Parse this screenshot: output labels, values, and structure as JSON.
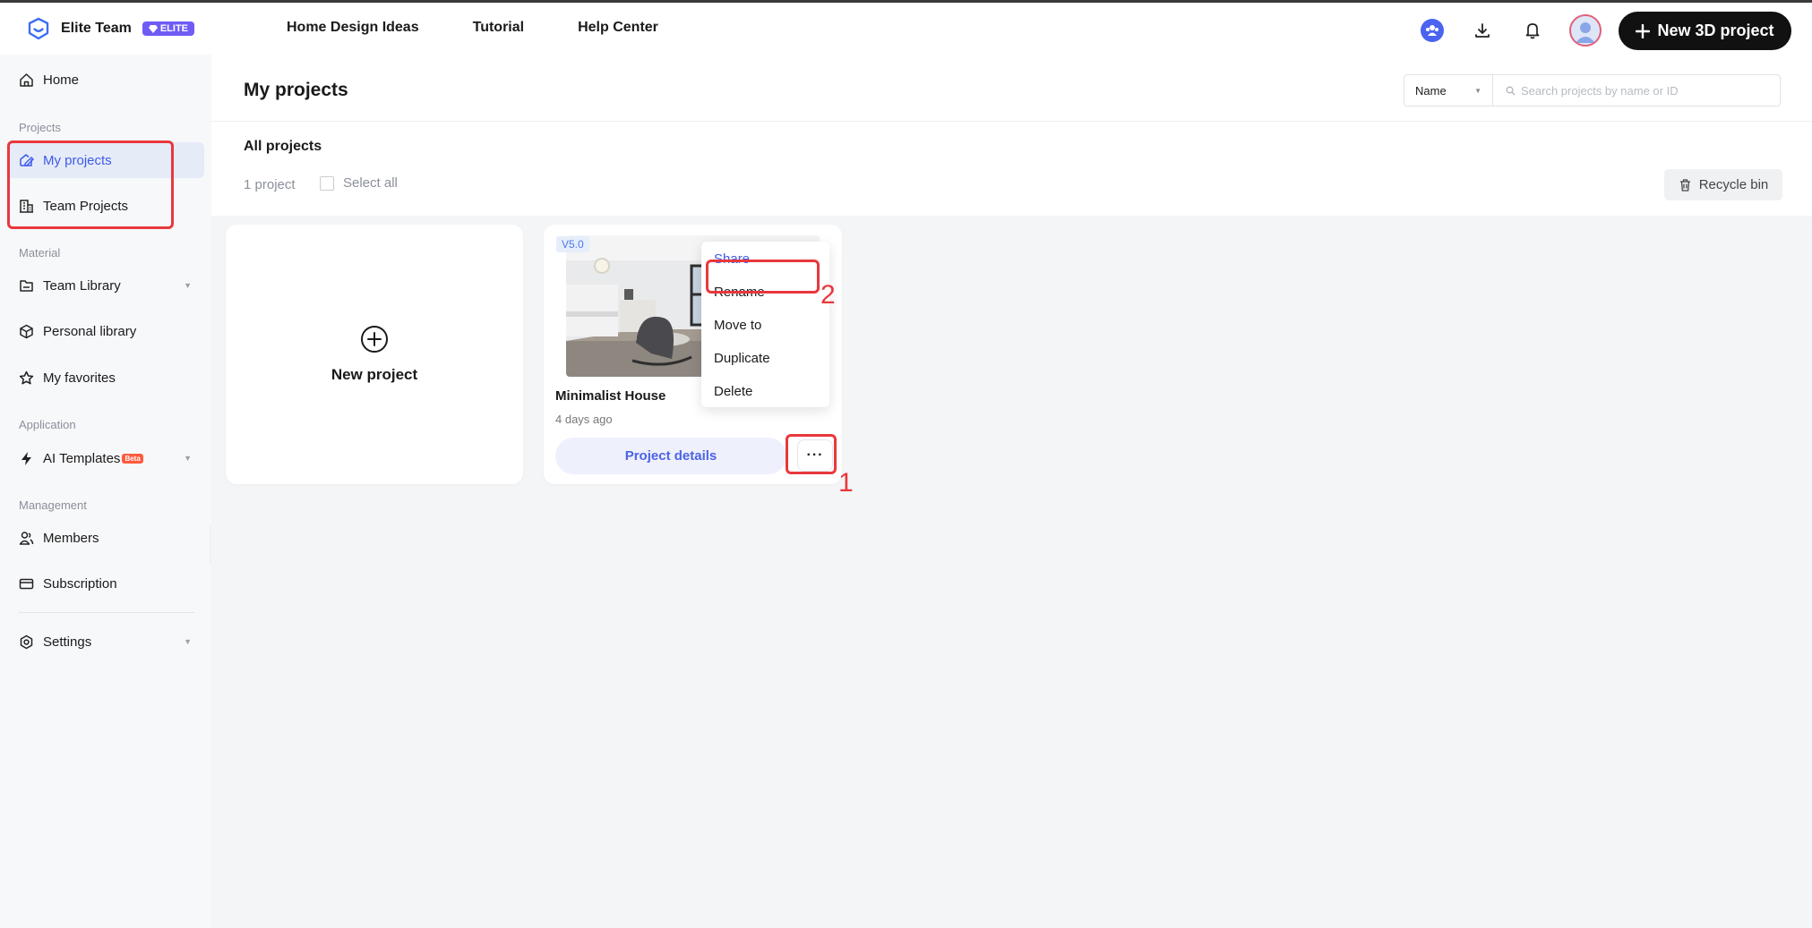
{
  "header": {
    "brand_name": "Elite Team",
    "badge_label": "ELITE",
    "nav": [
      "Home Design Ideas",
      "Tutorial",
      "Help Center"
    ],
    "new_project_label": "New 3D project"
  },
  "sidebar": {
    "home": "Home",
    "section_projects": "Projects",
    "my_projects": "My projects",
    "team_projects": "Team Projects",
    "section_material": "Material",
    "team_library": "Team Library",
    "personal_library": "Personal library",
    "my_favorites": "My favorites",
    "section_application": "Application",
    "ai_templates": "AI Templates",
    "beta_label": "Beta",
    "section_management": "Management",
    "members": "Members",
    "subscription": "Subscription",
    "settings": "Settings"
  },
  "main": {
    "title": "My projects",
    "sort_value": "Name",
    "search_placeholder": "Search projects by name or ID",
    "subtitle": "All projects",
    "count": "1 project",
    "select_all": "Select all",
    "recycle_bin": "Recycle bin",
    "new_project": "New project",
    "project": {
      "version": "V5.0",
      "name": "Minimalist House",
      "time": "4 days ago",
      "details_label": "Project details"
    },
    "menu": [
      "Share",
      "Rename",
      "Move to",
      "Duplicate",
      "Delete"
    ]
  },
  "annotations": {
    "step1": "1",
    "step2": "2"
  },
  "colors": {
    "accent": "#3c5be8",
    "annotation": "#e8383d",
    "badge": "#6f5cf5"
  }
}
